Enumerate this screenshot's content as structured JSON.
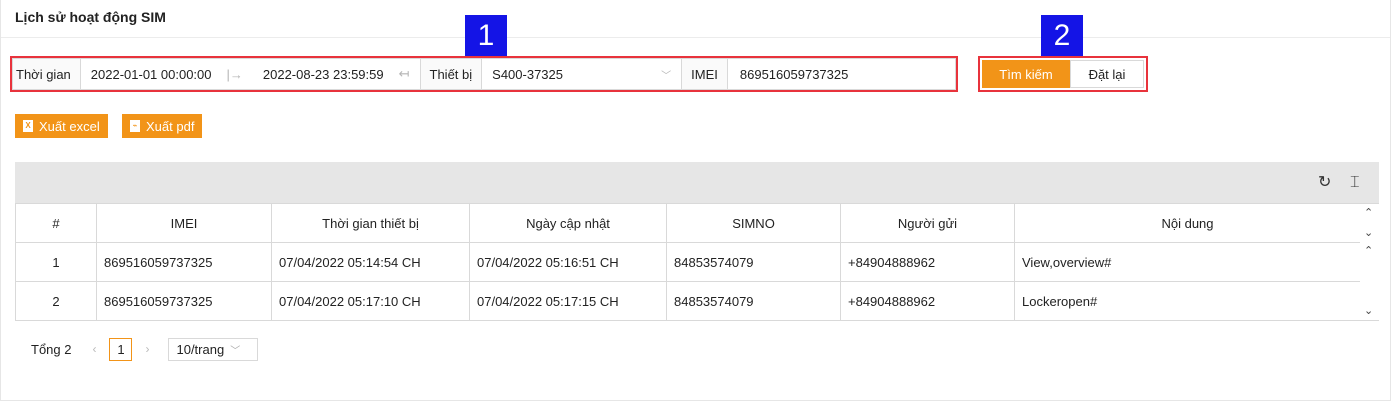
{
  "page": {
    "title": "Lịch sử hoạt động SIM"
  },
  "filters": {
    "time_label": "Thời gian",
    "date_from": "2022-01-01 00:00:00",
    "date_to": "2022-08-23 23:59:59",
    "device_label": "Thiết bị",
    "device_value": "S400-37325",
    "imei_label": "IMEI",
    "imei_value": "869516059737325"
  },
  "annotations": {
    "badge1": "1",
    "badge2": "2"
  },
  "buttons": {
    "search": "Tìm kiếm",
    "reset": "Đặt lại",
    "export_excel": "Xuất excel",
    "export_pdf": "Xuất pdf"
  },
  "table": {
    "headers": [
      "#",
      "IMEI",
      "Thời gian thiết bị",
      "Ngày cập nhật",
      "SIMNO",
      "Người gửi",
      "Nội dung"
    ],
    "rows": [
      [
        "1",
        "869516059737325",
        "07/04/2022 05:14:54 CH",
        "07/04/2022 05:16:51 CH",
        "84853574079",
        "+84904888962",
        "View,overview#"
      ],
      [
        "2",
        "869516059737325",
        "07/04/2022 05:17:10 CH",
        "07/04/2022 05:17:15 CH",
        "84853574079",
        "+84904888962",
        "Lockeropen#"
      ]
    ]
  },
  "pagination": {
    "total": "Tổng 2",
    "current_page": "1",
    "page_size": "10/trang"
  },
  "colors": {
    "accent": "#f29418",
    "highlight_border": "#e8333c",
    "badge": "#1414e6"
  },
  "icons": [
    "date-range-arrow-icon",
    "date-end-icon",
    "chevron-down-icon",
    "excel-file-icon",
    "pdf-file-icon",
    "refresh-icon",
    "row-height-icon",
    "chevron-left-icon",
    "chevron-right-icon"
  ]
}
